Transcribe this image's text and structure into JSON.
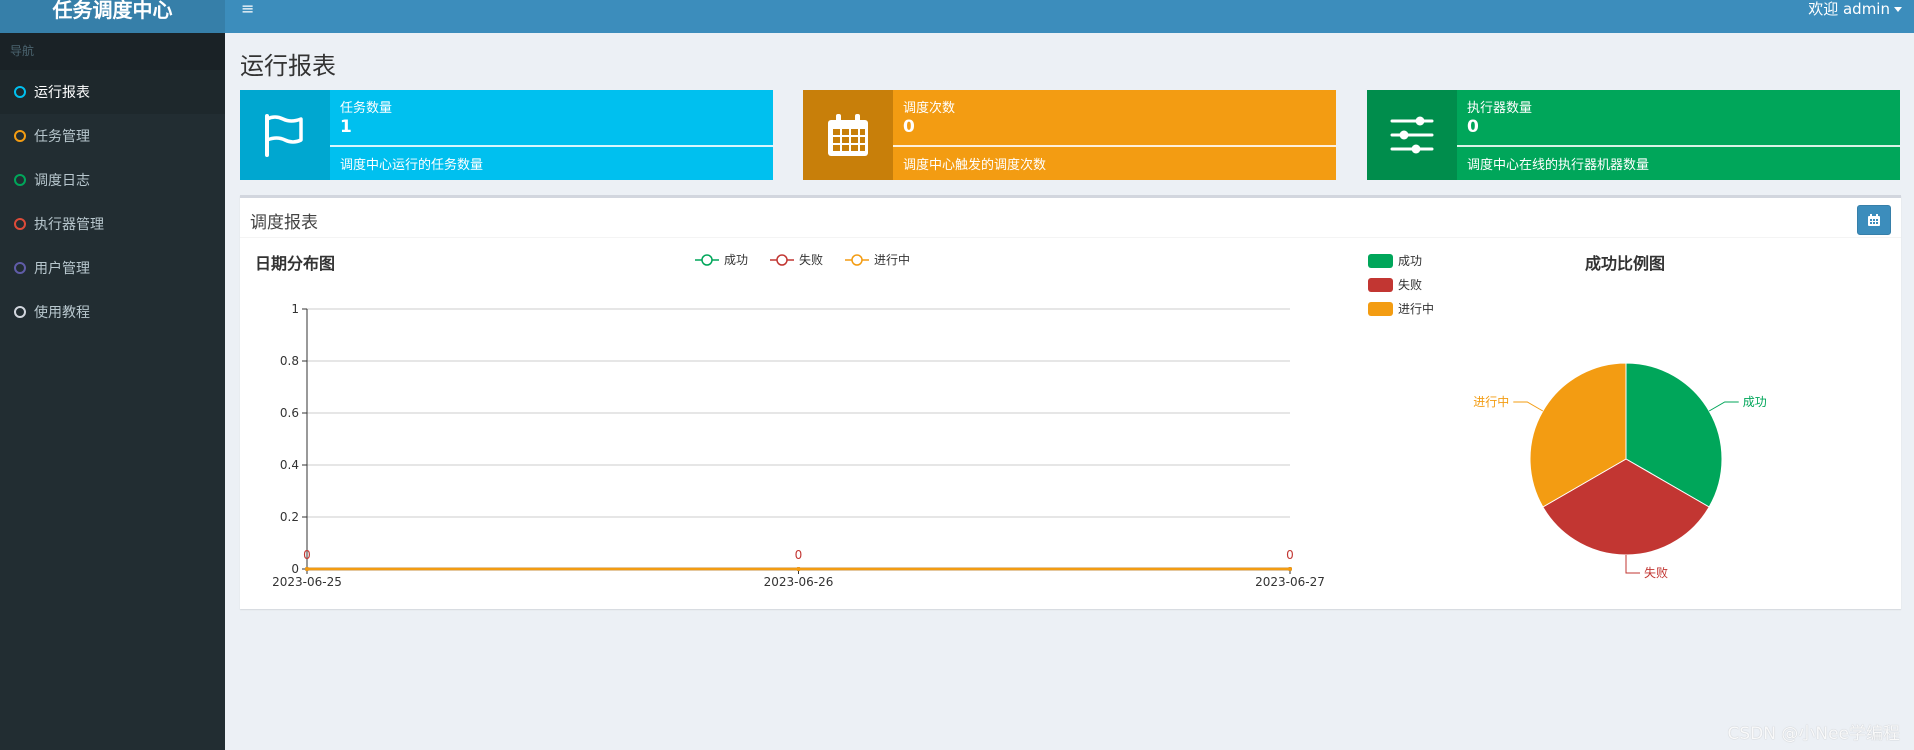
{
  "app": {
    "logo": "任务调度中心",
    "user_menu": "欢迎 admin"
  },
  "sidebar": {
    "header": "导航",
    "items": [
      {
        "label": "运行报表",
        "color": "#00c0ef"
      },
      {
        "label": "任务管理",
        "color": "#f39c12"
      },
      {
        "label": "调度日志",
        "color": "#00a65a"
      },
      {
        "label": "执行器管理",
        "color": "#dd4b39"
      },
      {
        "label": "用户管理",
        "color": "#605ca8"
      },
      {
        "label": "使用教程",
        "color": "#d2d6de"
      }
    ]
  },
  "page": {
    "title": "运行报表"
  },
  "info_boxes": [
    {
      "label": "任务数量",
      "number": "1",
      "desc": "调度中心运行的任务数量",
      "icon": "flag-icon",
      "color": "#00c0ef",
      "icon_bg": "#00a7d0"
    },
    {
      "label": "调度次数",
      "number": "0",
      "desc": "调度中心触发的调度次数",
      "icon": "calendar-icon",
      "color": "#f39c12",
      "icon_bg": "#c87f0a"
    },
    {
      "label": "执行器数量",
      "number": "0",
      "desc": "调度中心在线的执行器机器数量",
      "icon": "sliders-icon",
      "color": "#00a65a",
      "icon_bg": "#008d4c"
    }
  ],
  "report_box": {
    "title": "调度报表"
  },
  "chart_data": [
    {
      "type": "line",
      "title": "日期分布图",
      "x": [
        "2023-06-25",
        "2023-06-26",
        "2023-06-27"
      ],
      "ylim": [
        0,
        1
      ],
      "yticks": [
        "0",
        "0.2",
        "0.4",
        "0.6",
        "0.8",
        "1"
      ],
      "grid": true,
      "legend": "top-center",
      "series": [
        {
          "name": "成功",
          "color": "#00a65a",
          "values": [
            0,
            0,
            0
          ]
        },
        {
          "name": "失败",
          "color": "#c23632",
          "values": [
            0,
            0,
            0
          ]
        },
        {
          "name": "进行中",
          "color": "#f39c12",
          "values": [
            0,
            0,
            0
          ]
        }
      ],
      "data_labels": [
        "0",
        "0",
        "0"
      ]
    },
    {
      "type": "pie",
      "title": "成功比例图",
      "legend": "top-left",
      "slices": [
        {
          "name": "成功",
          "value": 1,
          "color": "#00a65a"
        },
        {
          "name": "失败",
          "value": 1,
          "color": "#c23632"
        },
        {
          "name": "进行中",
          "value": 1,
          "color": "#f39c12"
        }
      ]
    }
  ],
  "watermark": "CSDN @小Nee学编程"
}
